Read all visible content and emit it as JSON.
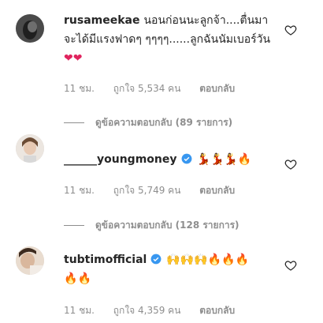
{
  "comments": [
    {
      "username": "rusameekae",
      "verified": false,
      "text": "นอนก่อนนะลูกจ้า....ตื่นมาจะได้มีแรงฟาดๆ ๆๆๆๆ......ลูกฉันนัมเบอร์วัน",
      "emojis": [
        "heart",
        "heart"
      ],
      "time": "11 ชม.",
      "likes": "ถูกใจ 5,534 คน",
      "reply": "ตอบกลับ",
      "view_replies": "ดูข้อความตอบกลับ (89 รายการ)"
    },
    {
      "username": "______youngmoney",
      "verified": true,
      "text": "",
      "emojis": [
        "woman-dancing",
        "woman-dancing",
        "woman-dancing",
        "fire"
      ],
      "time": "11 ชม.",
      "likes": "ถูกใจ 5,749 คน",
      "reply": "ตอบกลับ",
      "view_replies": "ดูข้อความตอบกลับ (128 รายการ)"
    },
    {
      "username": "tubtimofficial",
      "verified": true,
      "text": "",
      "emojis": [
        "raising-hands",
        "raising-hands",
        "raising-hands",
        "fire",
        "fire",
        "fire",
        "fire",
        "fire"
      ],
      "time": "11 ชม.",
      "likes": "ถูกใจ 4,359 คน",
      "reply": "ตอบกลับ",
      "view_replies": ""
    }
  ],
  "colors": {
    "meta": "#8e8e8e",
    "verified": "#3897f0",
    "heart": "#e0245e",
    "fire": "#ff6a00"
  }
}
